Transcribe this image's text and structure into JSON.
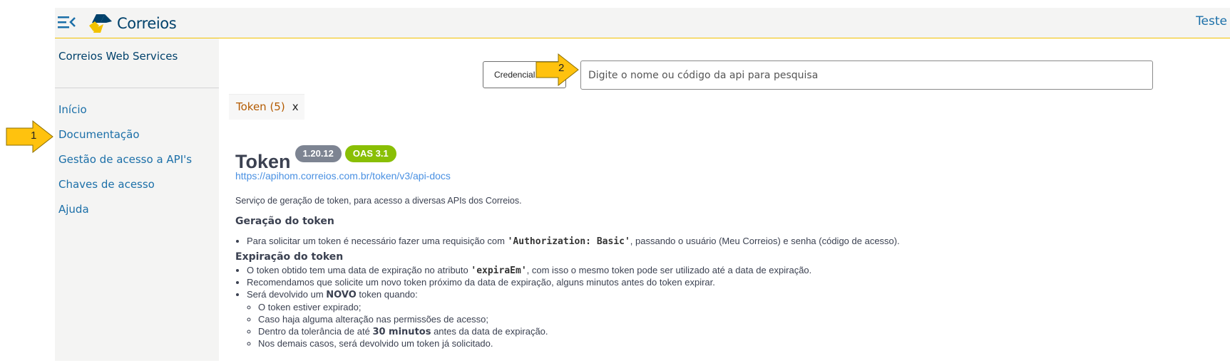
{
  "header": {
    "logo_text": "Correios",
    "user_name": "Teste",
    "colors": {
      "brand_blue": "#00416b",
      "brand_yellow": "#f2c200",
      "link": "#1b6fa8"
    }
  },
  "sidebar": {
    "title": "Correios Web Services",
    "items": [
      {
        "label": "Início"
      },
      {
        "label": "Documentação"
      },
      {
        "label": "Gestão de acesso a API's"
      },
      {
        "label": "Chaves de acesso"
      },
      {
        "label": "Ajuda"
      }
    ]
  },
  "toolbar": {
    "credentials_label": "Credencial",
    "search_placeholder": "Digite o nome ou código da api para pesquisa"
  },
  "tab": {
    "label": "Token (5)",
    "close_label": "x"
  },
  "api": {
    "title": "Token",
    "version": "1.20.12",
    "oas": "OAS 3.1",
    "url": "https://apihom.correios.com.br/token/v3/api-docs",
    "description": "Serviço de geração de token, para acesso a diversas APIs dos Correios.",
    "sections": {
      "generation": {
        "heading": "Geração do token",
        "bullet_pre": "Para solicitar um token é necessário fazer uma requisição com ",
        "bullet_code": "'Authorization: Basic'",
        "bullet_post": ", passando o usuário (Meu Correios) e senha (código de acesso)."
      },
      "expiration": {
        "heading": "Expiração do token",
        "b1_pre": "O token obtido tem uma data de expiração no atributo ",
        "b1_code": "'expiraEm'",
        "b1_post": ", com isso o mesmo token pode ser utilizado até a data de expiração.",
        "b2": "Recomendamos que solicite um novo token próximo da data de expiração, alguns minutos antes do token expirar.",
        "b3_pre": "Será devolvido um ",
        "b3_strong": "NOVO",
        "b3_post": " token quando:",
        "sub1": "O token estiver expirado;",
        "sub2": "Caso haja alguma alteração nas permissões de acesso;",
        "sub3_pre": "Dentro da tolerância de até ",
        "sub3_strong": "30 minutos",
        "sub3_post": " antes da data de expiração.",
        "sub4": "Nos demais casos, será devolvido um token já solicitado."
      }
    }
  },
  "annotations": {
    "arrow1_label": "1",
    "arrow2_label": "2",
    "arrow_color": "#ffc20e"
  }
}
